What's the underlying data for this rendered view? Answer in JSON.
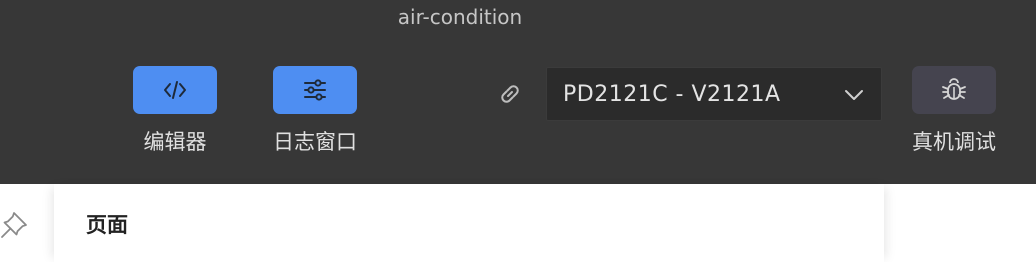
{
  "window": {
    "title": "air-condition"
  },
  "toolbar": {
    "editor_label": "编辑器",
    "log_label": "日志窗口",
    "debug_label": "真机调试",
    "device": {
      "selected": "PD2121C - V2121A"
    }
  },
  "content": {
    "page_title": "页面"
  },
  "colors": {
    "toolbar_bg": "#373737",
    "accent": "#4e8ef2",
    "debug_button_bg": "#45444f"
  }
}
